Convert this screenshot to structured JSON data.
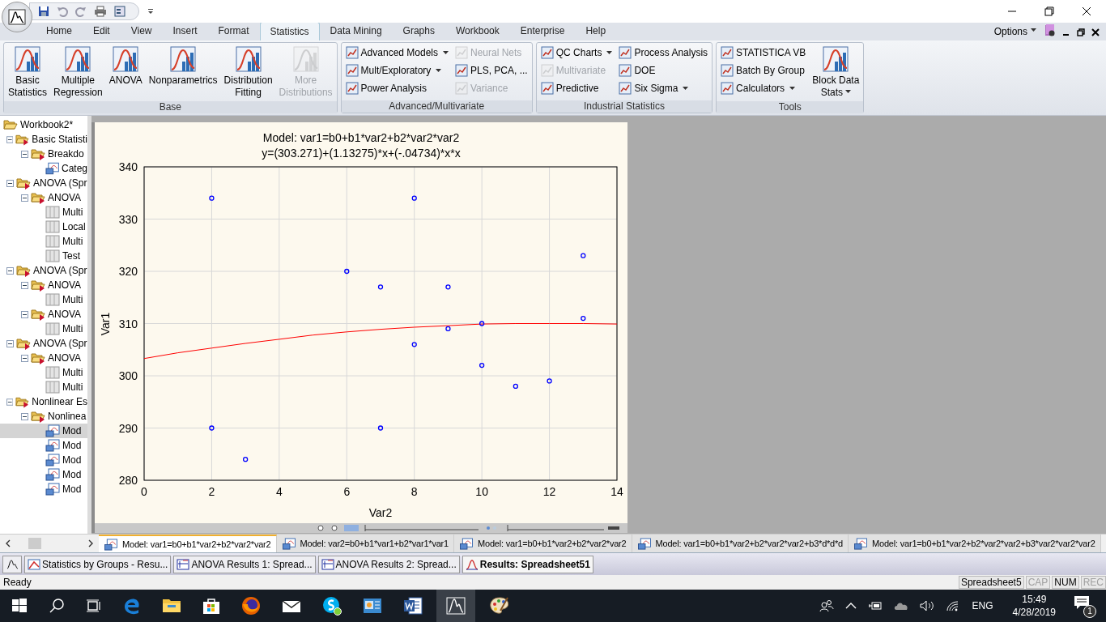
{
  "menu_tabs": [
    {
      "label": "Home",
      "selected": false
    },
    {
      "label": "Edit",
      "selected": false
    },
    {
      "label": "View",
      "selected": false
    },
    {
      "label": "Insert",
      "selected": false
    },
    {
      "label": "Format",
      "selected": false
    },
    {
      "label": "Statistics",
      "selected": true
    },
    {
      "label": "Data Mining",
      "selected": false
    },
    {
      "label": "Graphs",
      "selected": false
    },
    {
      "label": "Workbook",
      "selected": false
    },
    {
      "label": "Enterprise",
      "selected": false
    },
    {
      "label": "Help",
      "selected": false
    }
  ],
  "options": {
    "label": "Options"
  },
  "ribbon": [
    {
      "title": "Base",
      "items": [
        {
          "kind": "large",
          "lines": [
            "Basic",
            "Statistics"
          ],
          "disabled": false,
          "dropdown": false
        },
        {
          "kind": "large",
          "lines": [
            "Multiple",
            "Regression"
          ],
          "disabled": false,
          "dropdown": false
        },
        {
          "kind": "large",
          "lines": [
            "ANOVA"
          ],
          "disabled": false,
          "dropdown": false
        },
        {
          "kind": "large",
          "lines": [
            "Nonparametrics"
          ],
          "disabled": false,
          "dropdown": false
        },
        {
          "kind": "large",
          "lines": [
            "Distribution",
            "Fitting"
          ],
          "disabled": false,
          "dropdown": false
        },
        {
          "kind": "large",
          "lines": [
            "More",
            "Distributions"
          ],
          "disabled": true,
          "dropdown": false
        }
      ]
    },
    {
      "title": "Advanced/Multivariate",
      "items": [
        {
          "kind": "stack",
          "items": [
            {
              "label": "Advanced Models",
              "disabled": false,
              "dropdown": true
            },
            {
              "label": "Mult/Exploratory",
              "disabled": false,
              "dropdown": true
            },
            {
              "label": "Power Analysis",
              "disabled": false,
              "dropdown": false
            }
          ]
        },
        {
          "kind": "stack",
          "items": [
            {
              "label": "Neural Nets",
              "disabled": true,
              "dropdown": false
            },
            {
              "label": "PLS, PCA, ...",
              "disabled": false,
              "dropdown": false
            },
            {
              "label": "Variance",
              "disabled": true,
              "dropdown": false
            }
          ]
        }
      ]
    },
    {
      "title": "Industrial Statistics",
      "items": [
        {
          "kind": "stack",
          "items": [
            {
              "label": "QC Charts",
              "disabled": false,
              "dropdown": true
            },
            {
              "label": "Multivariate",
              "disabled": true,
              "dropdown": false
            },
            {
              "label": "Predictive",
              "disabled": false,
              "dropdown": false
            }
          ]
        },
        {
          "kind": "stack",
          "items": [
            {
              "label": "Process Analysis",
              "disabled": false,
              "dropdown": false
            },
            {
              "label": "DOE",
              "disabled": false,
              "dropdown": false
            },
            {
              "label": "Six Sigma",
              "disabled": false,
              "dropdown": true
            }
          ]
        }
      ]
    },
    {
      "title": "Tools",
      "items": [
        {
          "kind": "stack",
          "items": [
            {
              "label": "STATISTICA VB",
              "disabled": false,
              "dropdown": false
            },
            {
              "label": "Batch By Group",
              "disabled": false,
              "dropdown": false
            },
            {
              "label": "Calculators",
              "disabled": false,
              "dropdown": true
            }
          ]
        },
        {
          "kind": "large",
          "lines": [
            "Block Data",
            "Stats"
          ],
          "disabled": false,
          "dropdown": true
        }
      ]
    }
  ],
  "tree": {
    "label": "Workbook2*",
    "kind": "workbook",
    "selected": false,
    "children": [
      {
        "label": "Basic Statisti",
        "kind": "report",
        "selected": false,
        "expanded": true,
        "children": [
          {
            "label": "Breakdo",
            "kind": "report",
            "selected": false,
            "expanded": true,
            "children": [
              {
                "label": "Categ",
                "kind": "graph",
                "selected": false
              }
            ]
          }
        ]
      },
      {
        "label": "ANOVA (Spr",
        "kind": "report",
        "selected": false,
        "expanded": true,
        "children": [
          {
            "label": "ANOVA",
            "kind": "report",
            "selected": false,
            "expanded": true,
            "children": [
              {
                "label": "Multi",
                "kind": "sheet",
                "selected": false
              },
              {
                "label": "Local",
                "kind": "sheet",
                "selected": false
              },
              {
                "label": "Multi",
                "kind": "sheet",
                "selected": false
              },
              {
                "label": "Test",
                "kind": "sheet",
                "selected": false
              }
            ]
          }
        ]
      },
      {
        "label": "ANOVA (Spr",
        "kind": "report",
        "selected": false,
        "expanded": true,
        "children": [
          {
            "label": "ANOVA",
            "kind": "report",
            "selected": false,
            "expanded": true,
            "children": [
              {
                "label": "Multi",
                "kind": "sheet",
                "selected": false
              }
            ]
          },
          {
            "label": "ANOVA",
            "kind": "report",
            "selected": false,
            "expanded": true,
            "children": [
              {
                "label": "Multi",
                "kind": "sheet",
                "selected": false
              }
            ]
          }
        ]
      },
      {
        "label": "ANOVA (Spr",
        "kind": "report",
        "selected": false,
        "expanded": true,
        "children": [
          {
            "label": "ANOVA",
            "kind": "report",
            "selected": false,
            "expanded": true,
            "children": [
              {
                "label": "Multi",
                "kind": "sheet",
                "selected": false
              },
              {
                "label": "Multi",
                "kind": "sheet",
                "selected": false
              }
            ]
          }
        ]
      },
      {
        "label": "Nonlinear Es",
        "kind": "report",
        "selected": false,
        "expanded": true,
        "children": [
          {
            "label": "Nonlinea",
            "kind": "report",
            "selected": false,
            "expanded": true,
            "children": [
              {
                "label": "Mod",
                "kind": "graph",
                "selected": true
              },
              {
                "label": "Mod",
                "kind": "graph",
                "selected": false
              },
              {
                "label": "Mod",
                "kind": "graph",
                "selected": false
              },
              {
                "label": "Mod",
                "kind": "graph",
                "selected": false
              },
              {
                "label": "Mod",
                "kind": "graph",
                "selected": false
              }
            ]
          }
        ]
      }
    ]
  },
  "graph": {
    "chart_data": {
      "type": "scatter",
      "title": "Model: var1=b0+b1*var2+b2*var2*var2",
      "subtitle": "y=(303.271)+(1.13275)*x+(-.04734)*x*x",
      "xlabel": "Var2",
      "ylabel": "Var1",
      "grid": true,
      "xlim": [
        0,
        14
      ],
      "ylim": [
        280,
        340
      ],
      "xticks": [
        0,
        2,
        4,
        6,
        8,
        10,
        12,
        14
      ],
      "yticks": [
        280,
        290,
        300,
        310,
        320,
        330,
        340
      ],
      "x": [
        2,
        2,
        3,
        6,
        7,
        7,
        8,
        8,
        9,
        9,
        10,
        10,
        11,
        12,
        13,
        13
      ],
      "series": [
        {
          "color": "#0000ff",
          "values": [
            334,
            290,
            284,
            320,
            317,
            290,
            334,
            306,
            317,
            309,
            310,
            302,
            298,
            299,
            323,
            311
          ]
        },
        {
          "color": "#ff0000",
          "type": "line",
          "x": [
            0,
            1,
            2,
            3,
            4,
            5,
            6,
            7,
            8,
            9,
            10,
            11,
            12,
            13,
            14
          ],
          "values": [
            303.3,
            304.4,
            305.3,
            306.2,
            307,
            307.8,
            308.4,
            308.9,
            309.3,
            309.6,
            309.9,
            310,
            310,
            310,
            309.9
          ]
        }
      ]
    }
  },
  "doc_tabs": [
    {
      "label": "Model: var1=b0+b1*var2+b2*var2*var2",
      "selected": true
    },
    {
      "label": "Model: var2=b0+b1*var1+b2*var1*var1",
      "selected": false
    },
    {
      "label": "Model: var1=b0+b1*var2+b2*var2*var2",
      "selected": false
    },
    {
      "label": "Model: var1=b0+b1*var2+b2*var2*var2+b3*d*d*d",
      "selected": false
    },
    {
      "label": "Model: var1=b0+b1*var2+b2*var2*var2+b3*var2*var2*var2",
      "selected": false
    }
  ],
  "windows": [
    {
      "label": "Statistics by Groups - Resu...",
      "kind": "chart",
      "selected": false
    },
    {
      "label": "ANOVA Results 1: Spread...",
      "kind": "sheet",
      "selected": false
    },
    {
      "label": "ANOVA Results 2: Spread...",
      "kind": "sheet",
      "selected": false
    },
    {
      "label": "Results: Spreadsheet51",
      "kind": "curve",
      "selected": true
    }
  ],
  "status_bar": {
    "text": "Ready",
    "indicators": [
      {
        "label": "Spreadsheet5",
        "disabled": false
      },
      {
        "label": "CAP",
        "disabled": true
      },
      {
        "label": "NUM",
        "disabled": false
      },
      {
        "label": "REC",
        "disabled": true
      }
    ]
  },
  "taskbar": {
    "language": "ENG",
    "time": "15:49",
    "date": "4/28/2019",
    "notifications": "1"
  }
}
